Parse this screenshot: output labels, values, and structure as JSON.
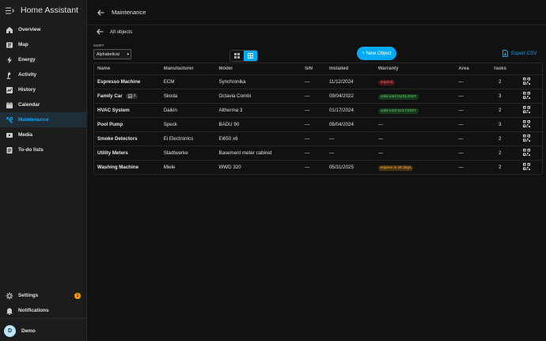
{
  "app_title": "Home Assistant",
  "page_title": "Maintenance",
  "sidebar": {
    "items": [
      {
        "label": "Overview",
        "icon": "overview-icon"
      },
      {
        "label": "Map",
        "icon": "map-icon"
      },
      {
        "label": "Energy",
        "icon": "energy-icon"
      },
      {
        "label": "Activity",
        "icon": "activity-icon"
      },
      {
        "label": "History",
        "icon": "history-icon"
      },
      {
        "label": "Calendar",
        "icon": "calendar-icon"
      },
      {
        "label": "Maintenance",
        "icon": "maintenance-icon"
      },
      {
        "label": "Media",
        "icon": "media-icon"
      },
      {
        "label": "To-do lists",
        "icon": "todo-icon"
      }
    ],
    "settings_label": "Settings",
    "settings_badge": "1",
    "notifications_label": "Notifications",
    "user_name": "Demo",
    "user_initial": "D"
  },
  "toolbar": {
    "breadcrumb": "All objects",
    "sort_label": "SORT",
    "sort_value": "Alphabetical",
    "new_button": "+ New Object",
    "export_button": "Export CSV"
  },
  "table": {
    "headers": {
      "name": "Name",
      "manufacturer": "Manufacturer",
      "model": "Model",
      "sn": "S/N",
      "installed": "Installed",
      "warranty": "Warranty",
      "area": "Area",
      "tasks": "Tasks"
    },
    "rows": [
      {
        "name": "Espresso Machine",
        "chip": "",
        "manufacturer": "ECM",
        "model": "Synchronika",
        "sn": "—",
        "installed": "11/12/2024",
        "warranty": "expired",
        "warranty_status": "red",
        "area": "—",
        "tasks": "2"
      },
      {
        "name": "Family Car",
        "chip": "2",
        "manufacturer": "Skoda",
        "model": "Octavia Combi",
        "sn": "—",
        "installed": "09/04/2022",
        "warranty": "valid until 01/31/2027",
        "warranty_status": "green",
        "area": "—",
        "tasks": "3"
      },
      {
        "name": "HVAC System",
        "chip": "",
        "manufacturer": "Daikin",
        "model": "Altherma 3",
        "sn": "—",
        "installed": "01/17/2024",
        "warranty": "valid until 11/17/2027",
        "warranty_status": "green",
        "area": "—",
        "tasks": "2"
      },
      {
        "name": "Pool Pump",
        "chip": "",
        "manufacturer": "Speck",
        "model": "BADU 90",
        "sn": "—",
        "installed": "08/04/2024",
        "warranty": "—",
        "warranty_status": "none",
        "area": "—",
        "tasks": "3"
      },
      {
        "name": "Smoke Detectors",
        "chip": "",
        "manufacturer": "Ei Electronics",
        "model": "Ei650 x6",
        "sn": "—",
        "installed": "—",
        "warranty": "—",
        "warranty_status": "none",
        "area": "—",
        "tasks": "2"
      },
      {
        "name": "Utility Meters",
        "chip": "",
        "manufacturer": "Stadtwerke",
        "model": "Basement meter cabinet",
        "sn": "—",
        "installed": "—",
        "warranty": "—",
        "warranty_status": "none",
        "area": "—",
        "tasks": "2"
      },
      {
        "name": "Washing Machine",
        "chip": "",
        "manufacturer": "Miele",
        "model": "WWD 320",
        "sn": "—",
        "installed": "05/31/2025",
        "warranty": "expires in 26 days",
        "warranty_status": "orange",
        "area": "—",
        "tasks": "2"
      }
    ]
  }
}
